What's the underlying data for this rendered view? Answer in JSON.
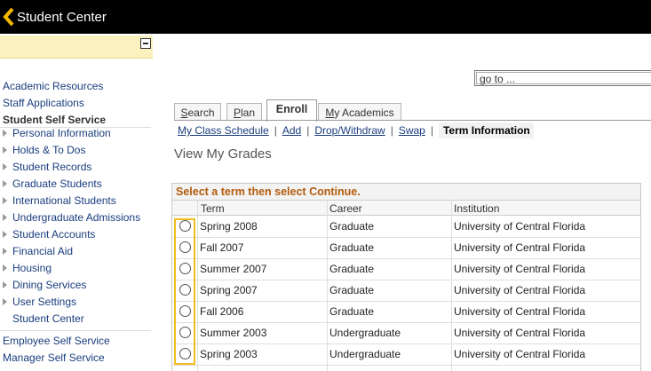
{
  "header": {
    "title": "Student Center"
  },
  "menu": {
    "links_top": [
      "Academic Resources",
      "Staff Applications"
    ],
    "section_title": "Student Self Service",
    "items": [
      "Personal Information",
      "Holds & To Dos",
      "Student Records",
      "Graduate Students",
      "International Students",
      "Undergraduate Admissions",
      "Student Accounts",
      "Financial Aid",
      "Housing",
      "Dining Services",
      "User Settings"
    ],
    "plain_item": "Student Center",
    "links_bottom": [
      "Employee Self Service",
      "Manager Self Service"
    ]
  },
  "goto": {
    "placeholder": "go to ..."
  },
  "tabs": {
    "search": {
      "first": "S",
      "rest": "earch"
    },
    "plan": {
      "first": "P",
      "rest": "lan"
    },
    "enroll": "Enroll",
    "academics": {
      "first": "M",
      "rest": "y Academics"
    }
  },
  "subnav": {
    "schedule": "My Class Schedule",
    "add": "Add",
    "drop": "Drop/Withdraw",
    "swap": "Swap",
    "current": "Term Information"
  },
  "page_title": "View My Grades",
  "grid": {
    "caption": "Select a term then select Continue.",
    "headers": {
      "term": "Term",
      "career": "Career",
      "institution": "Institution"
    },
    "rows": [
      {
        "term": "Spring 2008",
        "career": "Graduate",
        "institution": "University of Central Florida"
      },
      {
        "term": "Fall 2007",
        "career": "Graduate",
        "institution": "University of Central Florida"
      },
      {
        "term": "Summer 2007",
        "career": "Graduate",
        "institution": "University of Central Florida"
      },
      {
        "term": "Spring 2007",
        "career": "Graduate",
        "institution": "University of Central Florida"
      },
      {
        "term": "Fall 2006",
        "career": "Graduate",
        "institution": "University of Central Florida"
      },
      {
        "term": "Summer 2003",
        "career": "Undergraduate",
        "institution": "University of Central Florida"
      },
      {
        "term": "Spring 2003",
        "career": "Undergraduate",
        "institution": "University of Central Florida"
      }
    ]
  },
  "colors": {
    "header_bg": "#000000",
    "accent": "#f5b800",
    "link": "#1a3d7e",
    "caption": "#b35b0b",
    "collapse_bar": "#fbf1bf"
  }
}
